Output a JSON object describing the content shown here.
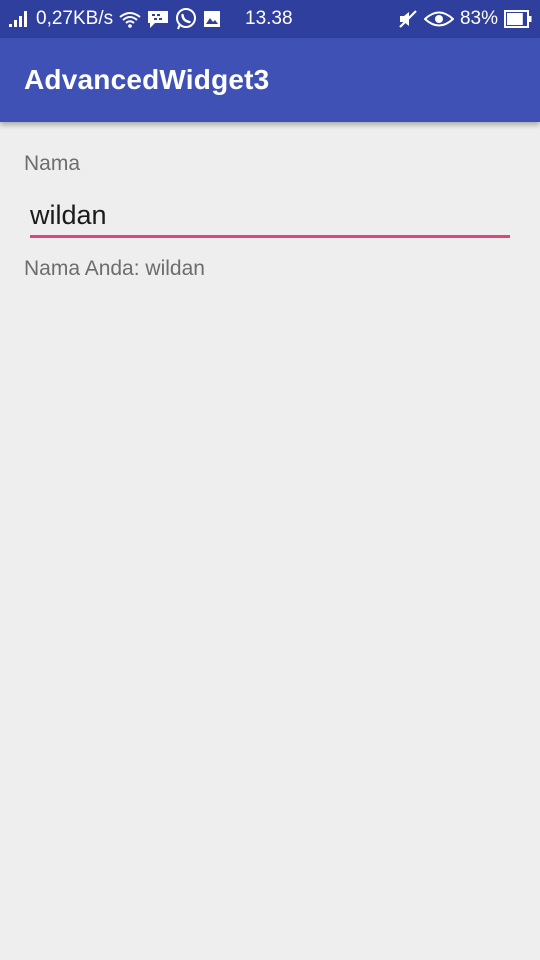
{
  "status_bar": {
    "network_speed": "0,27KB/s",
    "time": "13.38",
    "battery_percent": "83%",
    "battery_level": 0.83,
    "icons": [
      "signal-icon",
      "wifi-icon",
      "bbm-icon",
      "whatsapp-icon",
      "gallery-icon",
      "mute-icon",
      "eye-icon",
      "battery-icon"
    ]
  },
  "app_bar": {
    "title": "AdvancedWidget3",
    "color": "#3f51b5"
  },
  "form": {
    "label": "Nama",
    "input_value": "wildan",
    "result": "Nama Anda: wildan",
    "accent_color": "#e0457b"
  }
}
